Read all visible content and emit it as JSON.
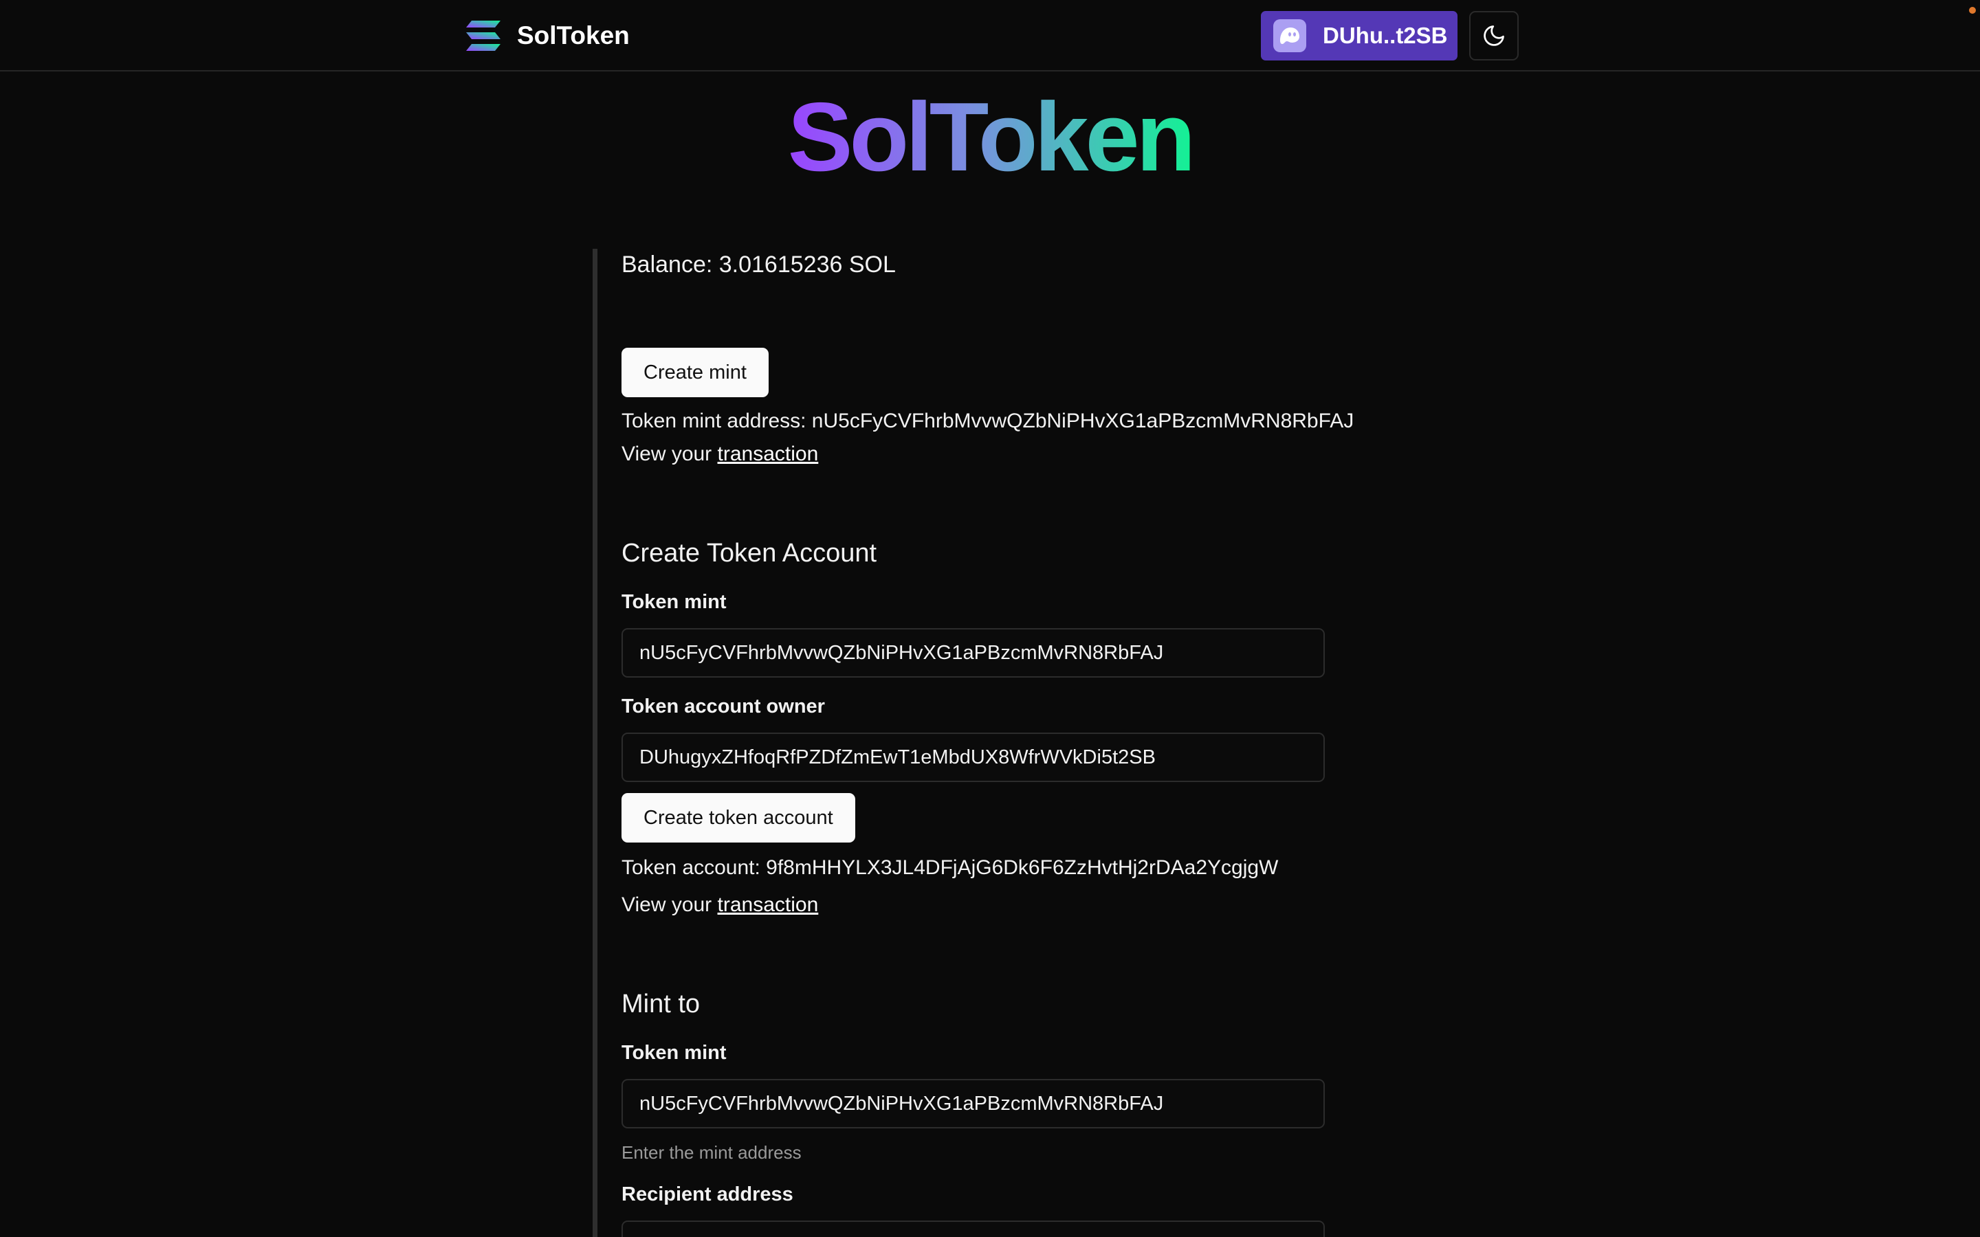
{
  "header": {
    "app_name": "SolToken",
    "wallet_label": "DUhu..t2SB",
    "theme_icon": "moon-icon"
  },
  "hero": {
    "title": "SolToken",
    "gradient": [
      "#9945ff",
      "#7a8fe0",
      "#14f195"
    ]
  },
  "balance": {
    "text": "Balance: 3.01615236 SOL"
  },
  "create_mint": {
    "button_label": "Create mint",
    "mint_address_text": "Token mint address: nU5cFyCVFhrbMvvwQZbNiPHvXG1aPBzcmMvRN8RbFAJ",
    "view_prefix": "View your",
    "view_link": "transaction"
  },
  "create_token_account": {
    "title": "Create Token Account",
    "mint_label": "Token mint",
    "mint_value": "nU5cFyCVFhrbMvvwQZbNiPHvXG1aPBzcmMvRN8RbFAJ",
    "owner_label": "Token account owner",
    "owner_value": "DUhugyxZHfoqRfPZDfZmEwT1eMbdUX8WfrWVkDi5t2SB",
    "button_label": "Create token account",
    "result_text": "Token account: 9f8mHHYLX3JL4DFjAjG6Dk6F6ZzHvtHj2rDAa2YcgjgW",
    "view_prefix": "View your",
    "view_link": "transaction"
  },
  "mint_to": {
    "title": "Mint to",
    "mint_label": "Token mint",
    "mint_value": "nU5cFyCVFhrbMvvwQZbNiPHvXG1aPBzcmMvRN8RbFAJ",
    "mint_helper": "Enter the mint address",
    "recipient_label": "Recipient address"
  },
  "colors": {
    "background": "#0a0a0a",
    "wallet_button": "#5438b6",
    "phantom_icon_bg": "#ab9ff2",
    "notification_dot": "#e0782c"
  }
}
